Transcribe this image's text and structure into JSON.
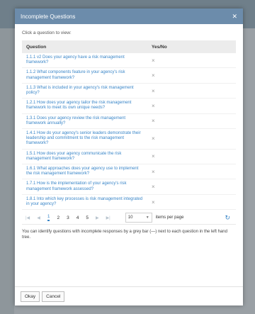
{
  "dialog": {
    "title": "Incomplete Questions",
    "close_icon": "close-icon",
    "instruction": "Click a question to view:",
    "columns": {
      "question": "Question",
      "yes_no": "Yes/No"
    },
    "rows": [
      {
        "question": "1.1.1 v2 Does your agency have a risk management framework?",
        "answer": "×"
      },
      {
        "question": "1.1.2 What components feature in your agency's risk management framework?",
        "answer": "×"
      },
      {
        "question": "1.1.3 What is included in your agency's risk management policy?",
        "answer": "×"
      },
      {
        "question": "1.2.1 How does your agency tailor the risk management framework to meet its own unique needs?",
        "answer": "×"
      },
      {
        "question": "1.3.1 Does your agency review the risk management framework annually?",
        "answer": "×"
      },
      {
        "question": "1.4.1 How do your agency's senior leaders demonstrate their leadership and commitment to the risk management framework?",
        "answer": "×"
      },
      {
        "question": "1.5.1 How does your agency communicate the risk management framework?",
        "answer": "×"
      },
      {
        "question": "1.6.1 What approaches does your agency use to implement the risk management framework?",
        "answer": "×"
      },
      {
        "question": "1.7.1 How is the implementation of your agency's risk management framework assessed?",
        "answer": "×"
      },
      {
        "question": "1.8.1 Into which key processes is risk management integrated in your agency?",
        "answer": "×"
      }
    ],
    "pager": {
      "first": "|◀",
      "prev": "◀",
      "pages": [
        "1",
        "2",
        "3",
        "4",
        "5"
      ],
      "current_page": "1",
      "next": "▶",
      "last": "▶|",
      "page_size": "10",
      "items_label": "items per page",
      "refresh_icon": "refresh-icon"
    },
    "footnote": "You can identify questions with incomplete responses by a grey bar (—) next to each question in the left hand tree.",
    "buttons": {
      "ok": "Okay",
      "cancel": "Cancel"
    }
  }
}
